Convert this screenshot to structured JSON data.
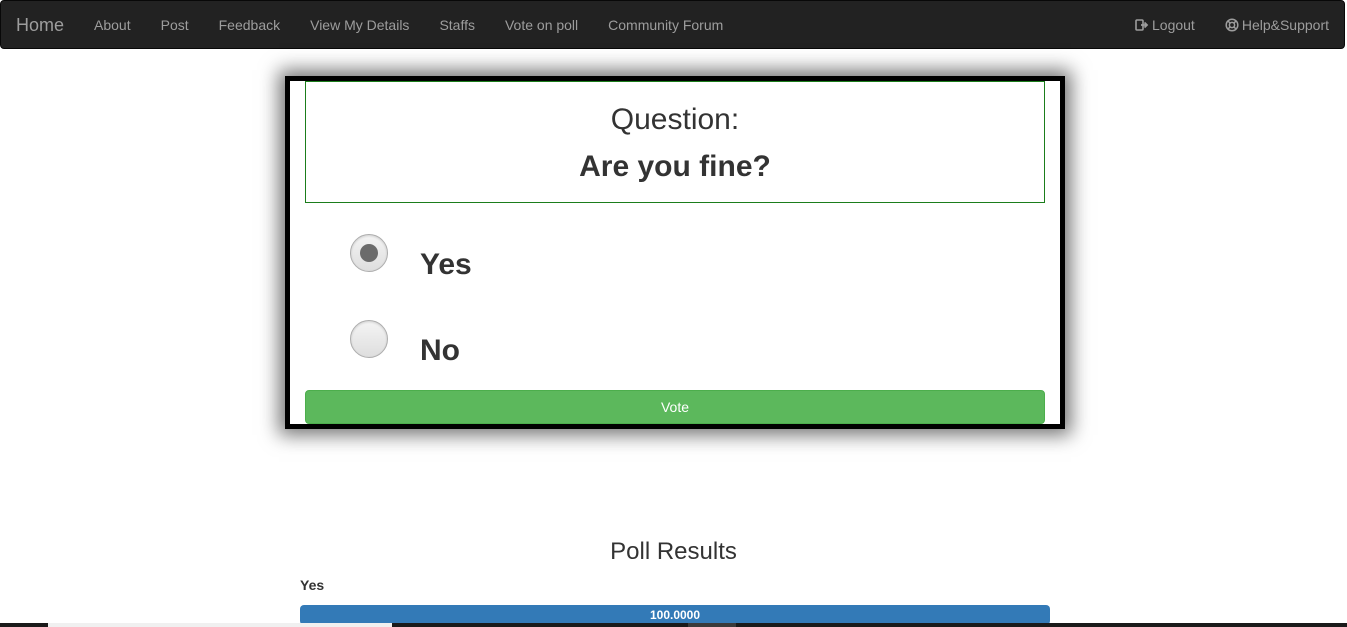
{
  "navbar": {
    "brand": "Home",
    "links": [
      "About",
      "Post",
      "Feedback",
      "View My Details",
      "Staffs",
      "Vote on poll",
      "Community Forum"
    ],
    "logout": {
      "label": "Logout",
      "icon": "logout-icon"
    },
    "help": {
      "label": "Help&Support",
      "icon": "lifebuoy-icon"
    }
  },
  "poll": {
    "question_label": "Question:",
    "question": "Are you fine?",
    "options": [
      {
        "label": "Yes",
        "selected": true
      },
      {
        "label": "No",
        "selected": false
      }
    ],
    "vote_label": "Vote"
  },
  "results": {
    "title": "Poll Results",
    "items": [
      {
        "label": "Yes",
        "value_text": "100.0000",
        "percent": 100
      }
    ]
  },
  "colors": {
    "navbar_bg": "#222222",
    "nav_text": "#9d9d9d",
    "vote_button": "#5cb85c",
    "progress_bar": "#337ab7",
    "question_border": "#1b7d1b"
  }
}
